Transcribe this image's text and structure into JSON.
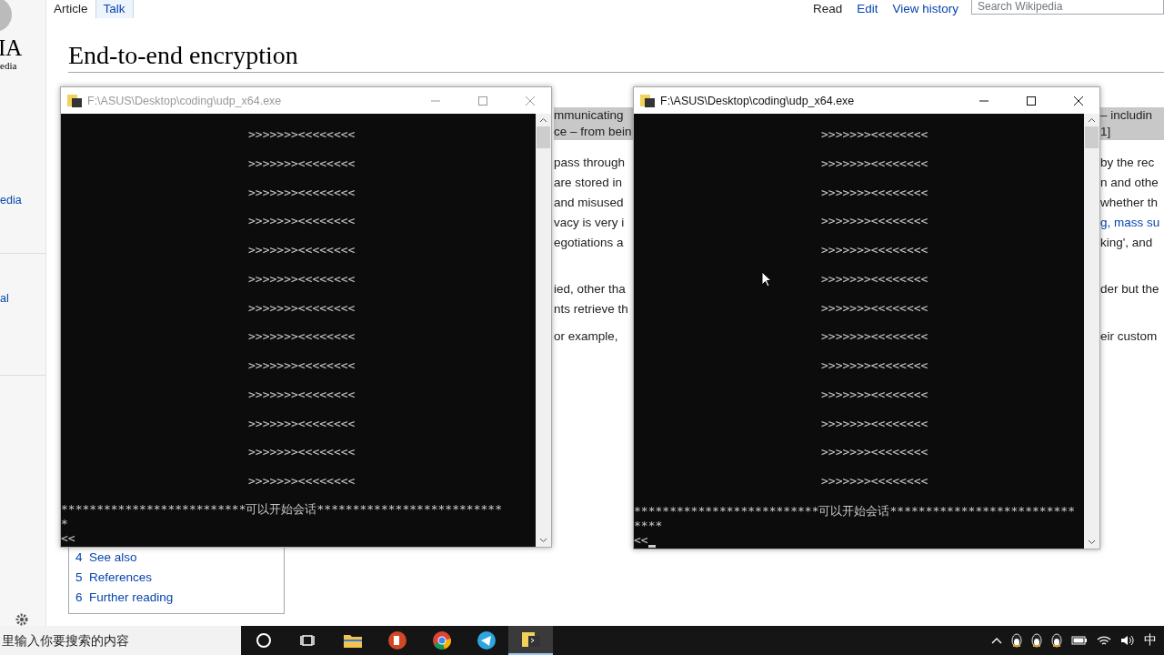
{
  "wiki": {
    "logo_text": "IA",
    "logo_subtext": "edia",
    "sidebar_links": [
      {
        "text": "edia"
      },
      {
        "text": "al"
      }
    ],
    "tabs_left": [
      {
        "label": "Article",
        "selected": true
      },
      {
        "label": "Talk",
        "selected": false
      }
    ],
    "tabs_right": [
      {
        "label": "Read",
        "selected": true
      },
      {
        "label": "Edit",
        "selected": false
      },
      {
        "label": "View history",
        "selected": false
      }
    ],
    "search": {
      "placeholder": "Search Wikipedia"
    },
    "title": "End-to-end encryption",
    "body_rows": [
      {
        "middle": "mmunicating",
        "right": "– includin",
        "highlighted": true
      },
      {
        "middle": "ce – from bein",
        "right": "1]",
        "highlighted": true
      },
      {
        "middle": "pass through",
        "right": "by the rec",
        "highlighted": false
      },
      {
        "middle": "are stored in",
        "right": "n and othe",
        "highlighted": false
      },
      {
        "middle": "and misused",
        "right": "whether th",
        "highlighted": false
      },
      {
        "middle": "vacy is very i",
        "right": "g, mass su",
        "right_link": true,
        "highlighted": false
      },
      {
        "middle": "egotiations a",
        "right": "king', and",
        "highlighted": false
      },
      {
        "middle": "ied, other tha",
        "right": "der but the",
        "highlighted": false
      },
      {
        "middle": "nts retrieve th",
        "highlighted": false
      },
      {
        "middle": "or example,",
        "right": "eir custom",
        "highlighted": false
      }
    ],
    "toc_items": [
      {
        "number": "4",
        "text": "See also"
      },
      {
        "number": "5",
        "text": "References"
      },
      {
        "number": "6",
        "text": "Further reading"
      }
    ]
  },
  "console_windows": [
    {
      "title": "F:\\ASUS\\Desktop\\coding\\udp_x64.exe",
      "active": false,
      "cursor": false,
      "lines": [
        ">>>>>>><<<<<<<<",
        ">>>>>>><<<<<<<<",
        ">>>>>>><<<<<<<<",
        ">>>>>>><<<<<<<<",
        ">>>>>>><<<<<<<<",
        ">>>>>>><<<<<<<<",
        ">>>>>>><<<<<<<<",
        ">>>>>>><<<<<<<<",
        ">>>>>>><<<<<<<<",
        ">>>>>>><<<<<<<<",
        ">>>>>>><<<<<<<<",
        ">>>>>>><<<<<<<<",
        ">>>>>>><<<<<<<<"
      ],
      "footer_lines": [
        "**************************可以开始会话**************************",
        "*",
        "<<"
      ]
    },
    {
      "title": "F:\\ASUS\\Desktop\\coding\\udp_x64.exe",
      "active": true,
      "cursor": true,
      "lines": [
        ">>>>>>><<<<<<<<",
        ">>>>>>><<<<<<<<",
        ">>>>>>><<<<<<<<",
        ">>>>>>><<<<<<<<",
        ">>>>>>><<<<<<<<",
        ">>>>>>><<<<<<<<",
        ">>>>>>><<<<<<<<",
        ">>>>>>><<<<<<<<",
        ">>>>>>><<<<<<<<",
        ">>>>>>><<<<<<<<",
        ">>>>>>><<<<<<<<",
        ">>>>>>><<<<<<<<",
        ">>>>>>><<<<<<<<"
      ],
      "footer_lines": [
        "**************************可以开始会话**************************",
        "****",
        "<<"
      ]
    }
  ],
  "taskbar": {
    "search_placeholder": "里输入你要搜索的内容",
    "apps": [
      {
        "kind": "cortana",
        "active": false
      },
      {
        "kind": "taskview",
        "active": false
      },
      {
        "kind": "folder",
        "active": false
      },
      {
        "kind": "powerpoint",
        "active": false
      },
      {
        "kind": "chrome",
        "active": false
      },
      {
        "kind": "telegram",
        "active": false
      },
      {
        "kind": "console",
        "active": true
      }
    ],
    "tray": [
      {
        "kind": "caret"
      },
      {
        "kind": "penguin"
      },
      {
        "kind": "penguin"
      },
      {
        "kind": "penguin"
      },
      {
        "kind": "battery"
      },
      {
        "kind": "wifi"
      },
      {
        "kind": "volume"
      }
    ],
    "ime": "中"
  }
}
